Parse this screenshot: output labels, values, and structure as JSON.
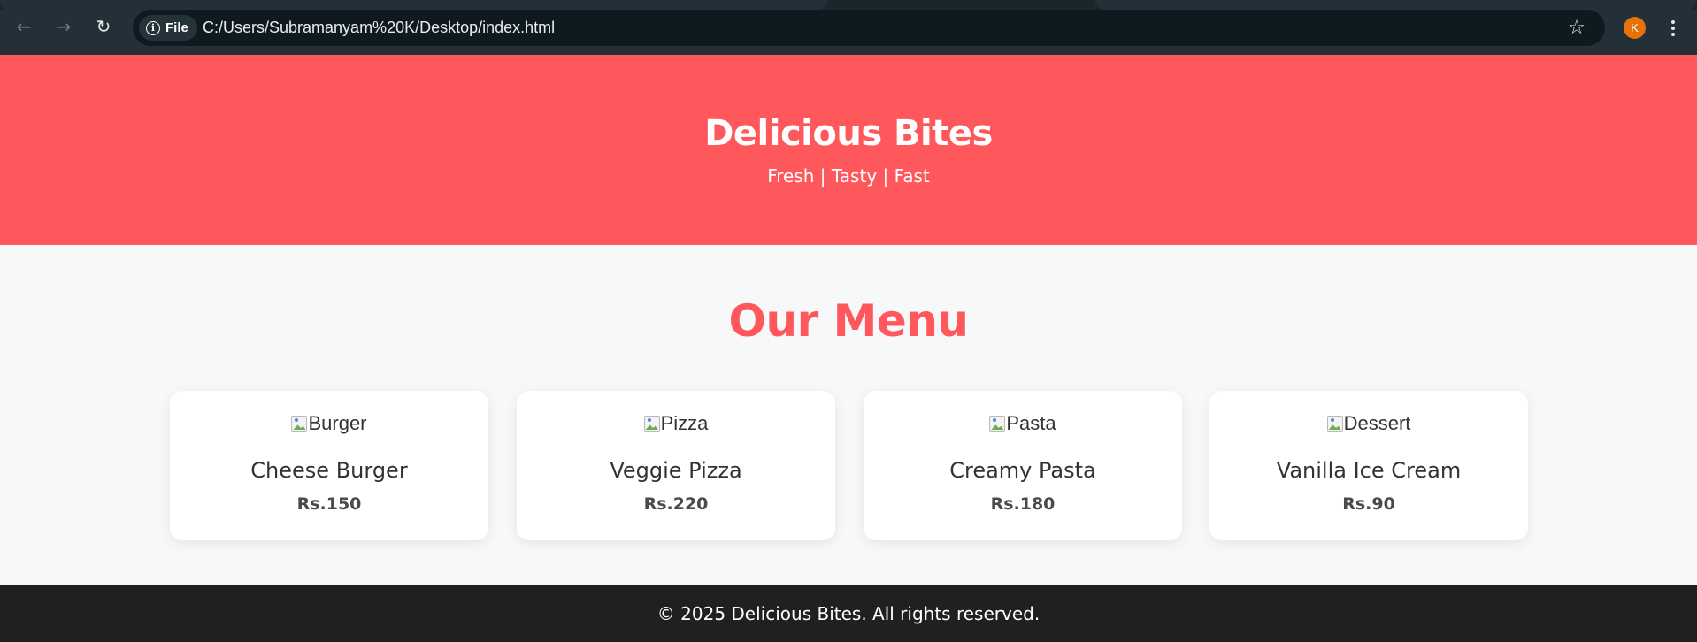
{
  "browser": {
    "back_icon": "arrow-left-icon",
    "forward_icon": "arrow-right-icon",
    "reload_icon": "reload-icon",
    "site_chip_label": "File",
    "url": "C:/Users/Subramanyam%20K/Desktop/index.html",
    "bookmark_icon": "star-icon",
    "profile_initial": "K",
    "profile_color": "#e8710a",
    "menu_icon": "more-vert-icon"
  },
  "hero": {
    "title": "Delicious Bites",
    "tagline": "Fresh | Tasty | Fast",
    "background": "#ff585c"
  },
  "menu": {
    "heading": "Our Menu",
    "items": [
      {
        "image_alt": "Burger",
        "name": "Cheese Burger",
        "price": "Rs.150"
      },
      {
        "image_alt": "Pizza",
        "name": "Veggie Pizza",
        "price": "Rs.220"
      },
      {
        "image_alt": "Pasta",
        "name": "Creamy Pasta",
        "price": "Rs.180"
      },
      {
        "image_alt": "Dessert",
        "name": "Vanilla Ice Cream",
        "price": "Rs.90"
      }
    ]
  },
  "footer": {
    "text": "© 2025 Delicious Bites. All rights reserved."
  }
}
